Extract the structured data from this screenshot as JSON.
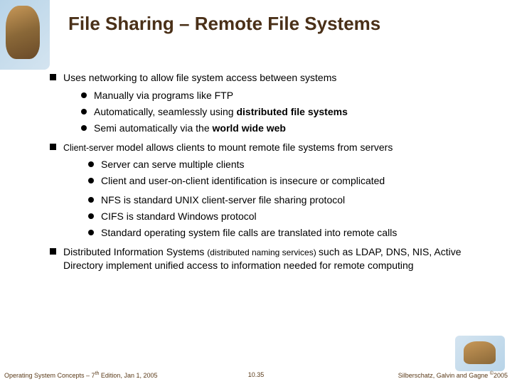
{
  "title": "File Sharing – Remote File Systems",
  "b1": "Uses networking to allow file system access between systems",
  "b1s1": "Manually via programs like FTP",
  "b1s2a": "Automatically, seamlessly using ",
  "b1s2b": "distributed file systems",
  "b1s3a": "Semi automatically via the ",
  "b1s3b": "world wide web",
  "b2a": "Client-server ",
  "b2b": "model allows clients to mount remote file systems from servers",
  "b2s1": "Server can serve multiple clients",
  "b2s2": "Client and user-on-client identification is insecure or complicated",
  "b2s3": "NFS is standard UNIX client-server file sharing protocol",
  "b2s4": "CIFS is standard Windows protocol",
  "b2s5": "Standard operating system file calls are translated into remote calls",
  "b3a": "Distributed Information Systems ",
  "b3b": "(distributed naming services) ",
  "b3c": "such as LDAP, DNS, NIS, Active Directory implement unified access to information needed for remote computing",
  "footer_left_a": "Operating System Concepts – 7",
  "footer_left_b": "th",
  "footer_left_c": " Edition, Jan 1, 2005",
  "footer_center": "10.35",
  "footer_right_a": "Silberschatz, Galvin and Gagne ",
  "footer_right_b": "©",
  "footer_right_c": "2005"
}
